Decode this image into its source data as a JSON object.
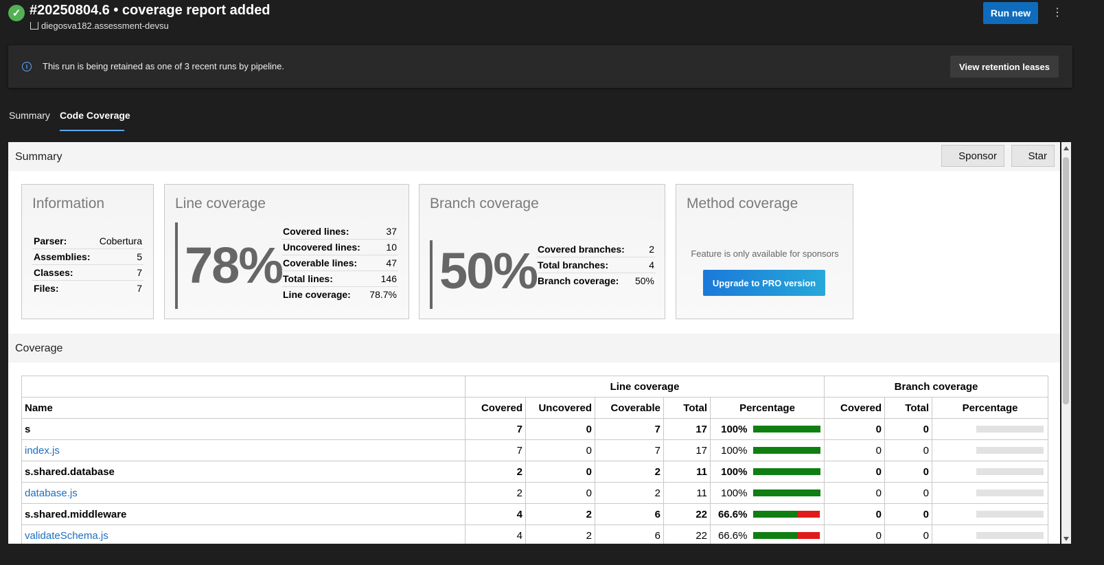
{
  "header": {
    "run_title": "#20250804.6 • coverage report added",
    "repo": "diegosva182.assessment-devsu",
    "run_new_label": "Run new",
    "more_icon": "⋮"
  },
  "banner": {
    "message": "This run is being retained as one of 3 recent runs by pipeline.",
    "button_label": "View retention leases"
  },
  "tabs": [
    {
      "label": "Summary"
    },
    {
      "label": "Code Coverage"
    }
  ],
  "report": {
    "summary_title": "Summary",
    "sponsor_label": "Sponsor",
    "star_label": "Star",
    "information": {
      "title": "Information",
      "rows": [
        {
          "k": "Parser:",
          "v": "Cobertura"
        },
        {
          "k": "Assemblies:",
          "v": "5"
        },
        {
          "k": "Classes:",
          "v": "7"
        },
        {
          "k": "Files:",
          "v": "7"
        }
      ]
    },
    "line_coverage": {
      "title": "Line coverage",
      "big": "78%",
      "rows": [
        {
          "k": "Covered lines:",
          "v": "37"
        },
        {
          "k": "Uncovered lines:",
          "v": "10"
        },
        {
          "k": "Coverable lines:",
          "v": "47"
        },
        {
          "k": "Total lines:",
          "v": "146"
        },
        {
          "k": "Line coverage:",
          "v": "78.7%"
        }
      ]
    },
    "branch_coverage": {
      "title": "Branch coverage",
      "big": "50%",
      "rows": [
        {
          "k": "Covered branches:",
          "v": "2"
        },
        {
          "k": "Total branches:",
          "v": "4"
        },
        {
          "k": "Branch coverage:",
          "v": "50%"
        }
      ]
    },
    "method_coverage": {
      "title": "Method coverage",
      "message": "Feature is only available for sponsors",
      "button_label": "Upgrade to PRO version"
    },
    "coverage_title": "Coverage",
    "table": {
      "group_line": "Line coverage",
      "group_branch": "Branch coverage",
      "headers": {
        "name": "Name",
        "covered": "Covered",
        "uncovered": "Uncovered",
        "coverable": "Coverable",
        "total": "Total",
        "percentage": "Percentage",
        "b_covered": "Covered",
        "b_total": "Total",
        "b_percentage": "Percentage"
      },
      "rows": [
        {
          "name": "s",
          "link": false,
          "covered": "7",
          "uncovered": "0",
          "coverable": "7",
          "total": "17",
          "pct": "100%",
          "line_pct": 100,
          "b_covered": "0",
          "b_total": "0",
          "b_pct": ""
        },
        {
          "name": "index.js",
          "link": true,
          "covered": "7",
          "uncovered": "0",
          "coverable": "7",
          "total": "17",
          "pct": "100%",
          "line_pct": 100,
          "b_covered": "0",
          "b_total": "0",
          "b_pct": ""
        },
        {
          "name": "s.shared.database",
          "link": false,
          "covered": "2",
          "uncovered": "0",
          "coverable": "2",
          "total": "11",
          "pct": "100%",
          "line_pct": 100,
          "b_covered": "0",
          "b_total": "0",
          "b_pct": ""
        },
        {
          "name": "database.js",
          "link": true,
          "covered": "2",
          "uncovered": "0",
          "coverable": "2",
          "total": "11",
          "pct": "100%",
          "line_pct": 100,
          "b_covered": "0",
          "b_total": "0",
          "b_pct": ""
        },
        {
          "name": "s.shared.middleware",
          "link": false,
          "covered": "4",
          "uncovered": "2",
          "coverable": "6",
          "total": "22",
          "pct": "66.6%",
          "line_pct": 66.6,
          "b_covered": "0",
          "b_total": "0",
          "b_pct": ""
        },
        {
          "name": "validateSchema.js",
          "link": true,
          "covered": "4",
          "uncovered": "2",
          "coverable": "6",
          "total": "22",
          "pct": "66.6%",
          "line_pct": 66.6,
          "b_covered": "0",
          "b_total": "0",
          "b_pct": ""
        }
      ]
    }
  },
  "colors": {
    "accent": "#0f6cbd",
    "bar_green": "#0f7f12",
    "bar_red": "#e01b1b",
    "bar_empty": "#e2e2e2",
    "success": "#54b054"
  }
}
